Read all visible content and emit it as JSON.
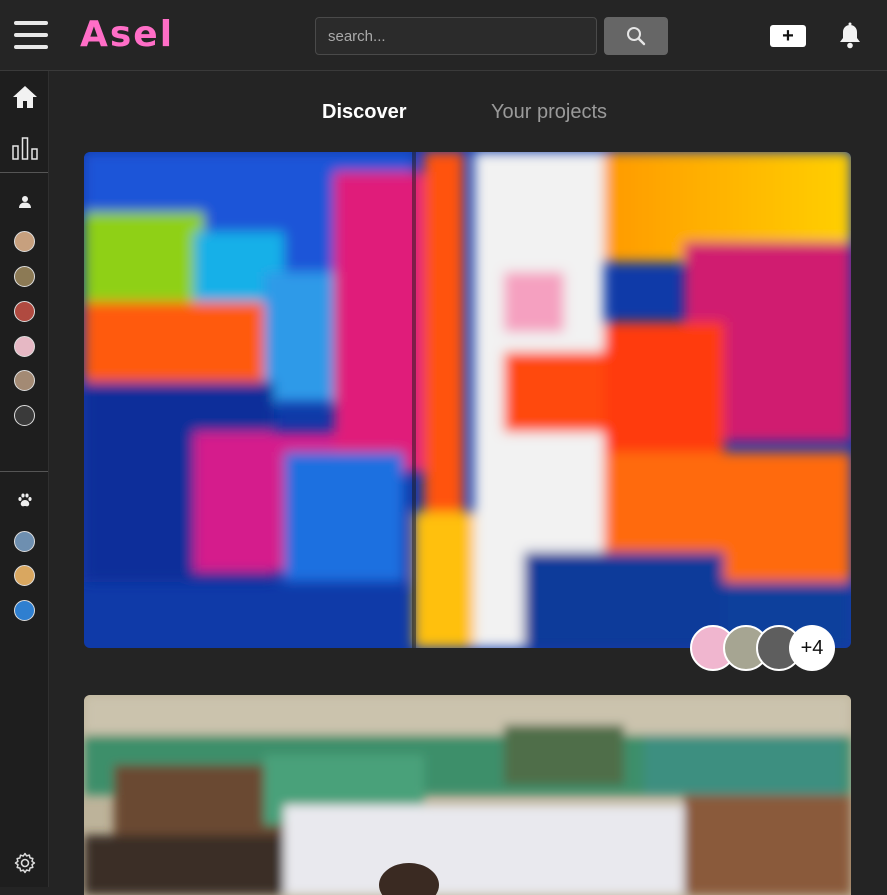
{
  "app": {
    "logo": "Asel"
  },
  "header": {
    "search_placeholder": "search...",
    "search_icon": "search-icon",
    "add_icon": "plus-icon",
    "notifications_icon": "bell-icon"
  },
  "sidebar": {
    "nav": [
      {
        "icon": "home-icon"
      },
      {
        "icon": "bar-chart-icon"
      }
    ],
    "people_icon": "person-icon",
    "people": [
      {
        "color": "#c7a07e"
      },
      {
        "color": "#8c7a55"
      },
      {
        "color": "#b04a40"
      },
      {
        "color": "#e6b8c4"
      },
      {
        "color": "#a38a74"
      },
      {
        "color": "#3a3a3a"
      }
    ],
    "groups_icon": "paw-icon",
    "groups": [
      {
        "color": "#6e8fb0"
      },
      {
        "color": "#d9a760"
      },
      {
        "color": "#2f7fd0"
      }
    ],
    "settings_icon": "gear-icon"
  },
  "tabs": [
    {
      "label": "Discover",
      "active": true
    },
    {
      "label": "Your projects",
      "active": false
    }
  ],
  "feed": {
    "cards": [
      {
        "type": "abstract-painting"
      },
      {
        "type": "graffiti-wall-photo"
      }
    ],
    "collaborators_extra": "+4"
  }
}
